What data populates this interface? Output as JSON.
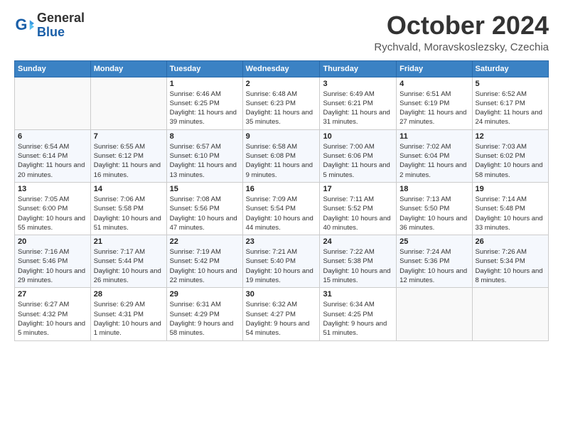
{
  "logo": {
    "line1": "General",
    "line2": "Blue"
  },
  "title": "October 2024",
  "subtitle": "Rychvald, Moravskoslezsky, Czechia",
  "weekdays": [
    "Sunday",
    "Monday",
    "Tuesday",
    "Wednesday",
    "Thursday",
    "Friday",
    "Saturday"
  ],
  "weeks": [
    [
      {
        "day": "",
        "info": ""
      },
      {
        "day": "",
        "info": ""
      },
      {
        "day": "1",
        "info": "Sunrise: 6:46 AM\nSunset: 6:25 PM\nDaylight: 11 hours and 39 minutes."
      },
      {
        "day": "2",
        "info": "Sunrise: 6:48 AM\nSunset: 6:23 PM\nDaylight: 11 hours and 35 minutes."
      },
      {
        "day": "3",
        "info": "Sunrise: 6:49 AM\nSunset: 6:21 PM\nDaylight: 11 hours and 31 minutes."
      },
      {
        "day": "4",
        "info": "Sunrise: 6:51 AM\nSunset: 6:19 PM\nDaylight: 11 hours and 27 minutes."
      },
      {
        "day": "5",
        "info": "Sunrise: 6:52 AM\nSunset: 6:17 PM\nDaylight: 11 hours and 24 minutes."
      }
    ],
    [
      {
        "day": "6",
        "info": "Sunrise: 6:54 AM\nSunset: 6:14 PM\nDaylight: 11 hours and 20 minutes."
      },
      {
        "day": "7",
        "info": "Sunrise: 6:55 AM\nSunset: 6:12 PM\nDaylight: 11 hours and 16 minutes."
      },
      {
        "day": "8",
        "info": "Sunrise: 6:57 AM\nSunset: 6:10 PM\nDaylight: 11 hours and 13 minutes."
      },
      {
        "day": "9",
        "info": "Sunrise: 6:58 AM\nSunset: 6:08 PM\nDaylight: 11 hours and 9 minutes."
      },
      {
        "day": "10",
        "info": "Sunrise: 7:00 AM\nSunset: 6:06 PM\nDaylight: 11 hours and 5 minutes."
      },
      {
        "day": "11",
        "info": "Sunrise: 7:02 AM\nSunset: 6:04 PM\nDaylight: 11 hours and 2 minutes."
      },
      {
        "day": "12",
        "info": "Sunrise: 7:03 AM\nSunset: 6:02 PM\nDaylight: 10 hours and 58 minutes."
      }
    ],
    [
      {
        "day": "13",
        "info": "Sunrise: 7:05 AM\nSunset: 6:00 PM\nDaylight: 10 hours and 55 minutes."
      },
      {
        "day": "14",
        "info": "Sunrise: 7:06 AM\nSunset: 5:58 PM\nDaylight: 10 hours and 51 minutes."
      },
      {
        "day": "15",
        "info": "Sunrise: 7:08 AM\nSunset: 5:56 PM\nDaylight: 10 hours and 47 minutes."
      },
      {
        "day": "16",
        "info": "Sunrise: 7:09 AM\nSunset: 5:54 PM\nDaylight: 10 hours and 44 minutes."
      },
      {
        "day": "17",
        "info": "Sunrise: 7:11 AM\nSunset: 5:52 PM\nDaylight: 10 hours and 40 minutes."
      },
      {
        "day": "18",
        "info": "Sunrise: 7:13 AM\nSunset: 5:50 PM\nDaylight: 10 hours and 36 minutes."
      },
      {
        "day": "19",
        "info": "Sunrise: 7:14 AM\nSunset: 5:48 PM\nDaylight: 10 hours and 33 minutes."
      }
    ],
    [
      {
        "day": "20",
        "info": "Sunrise: 7:16 AM\nSunset: 5:46 PM\nDaylight: 10 hours and 29 minutes."
      },
      {
        "day": "21",
        "info": "Sunrise: 7:17 AM\nSunset: 5:44 PM\nDaylight: 10 hours and 26 minutes."
      },
      {
        "day": "22",
        "info": "Sunrise: 7:19 AM\nSunset: 5:42 PM\nDaylight: 10 hours and 22 minutes."
      },
      {
        "day": "23",
        "info": "Sunrise: 7:21 AM\nSunset: 5:40 PM\nDaylight: 10 hours and 19 minutes."
      },
      {
        "day": "24",
        "info": "Sunrise: 7:22 AM\nSunset: 5:38 PM\nDaylight: 10 hours and 15 minutes."
      },
      {
        "day": "25",
        "info": "Sunrise: 7:24 AM\nSunset: 5:36 PM\nDaylight: 10 hours and 12 minutes."
      },
      {
        "day": "26",
        "info": "Sunrise: 7:26 AM\nSunset: 5:34 PM\nDaylight: 10 hours and 8 minutes."
      }
    ],
    [
      {
        "day": "27",
        "info": "Sunrise: 6:27 AM\nSunset: 4:32 PM\nDaylight: 10 hours and 5 minutes."
      },
      {
        "day": "28",
        "info": "Sunrise: 6:29 AM\nSunset: 4:31 PM\nDaylight: 10 hours and 1 minute."
      },
      {
        "day": "29",
        "info": "Sunrise: 6:31 AM\nSunset: 4:29 PM\nDaylight: 9 hours and 58 minutes."
      },
      {
        "day": "30",
        "info": "Sunrise: 6:32 AM\nSunset: 4:27 PM\nDaylight: 9 hours and 54 minutes."
      },
      {
        "day": "31",
        "info": "Sunrise: 6:34 AM\nSunset: 4:25 PM\nDaylight: 9 hours and 51 minutes."
      },
      {
        "day": "",
        "info": ""
      },
      {
        "day": "",
        "info": ""
      }
    ]
  ]
}
